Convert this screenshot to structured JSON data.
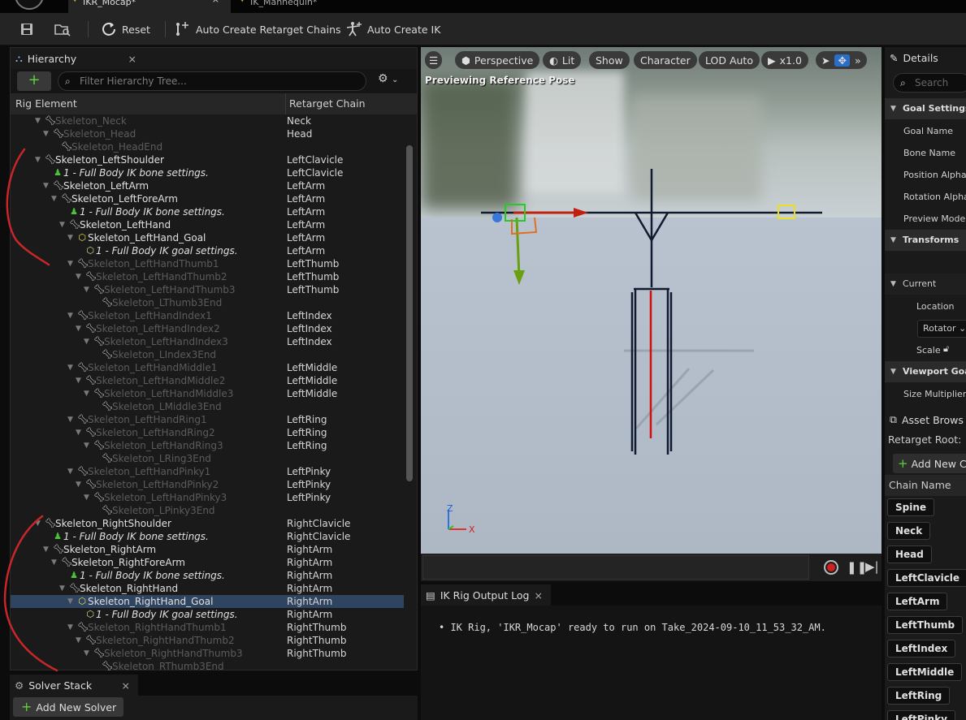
{
  "tabs": [
    {
      "label": "IKR_Mocap*"
    },
    {
      "label": "IK_Mannequin*"
    }
  ],
  "toolbar": {
    "reset_label": "Reset",
    "auto_chains_label": "Auto Create Retarget Chains",
    "auto_ik_label": "Auto Create IK"
  },
  "hierarchy": {
    "tab_label": "Hierarchy",
    "search_placeholder": "Filter Hierarchy Tree...",
    "col_element": "Rig Element",
    "col_chain": "Retarget Chain",
    "rows": [
      {
        "name": "Skeleton_Neck",
        "chain": "Neck",
        "indent": 0,
        "type": "bone",
        "style": "dim",
        "tri": "▼",
        "sel": false
      },
      {
        "name": "Skeleton_Head",
        "chain": "Head",
        "indent": 1,
        "type": "bone",
        "style": "dim",
        "tri": "▼",
        "sel": false
      },
      {
        "name": "Skeleton_HeadEnd",
        "chain": "",
        "indent": 2,
        "type": "bone",
        "style": "dim",
        "tri": "",
        "sel": false
      },
      {
        "name": "Skeleton_LeftShoulder",
        "chain": "LeftClavicle",
        "indent": 0,
        "type": "bone",
        "style": "lv",
        "tri": "▼",
        "sel": false
      },
      {
        "name": "1 - Full Body IK bone settings.",
        "chain": "LeftClavicle",
        "indent": 1,
        "type": "boneset",
        "style": "lv it",
        "tri": "",
        "sel": false
      },
      {
        "name": "Skeleton_LeftArm",
        "chain": "LeftArm",
        "indent": 1,
        "type": "bone",
        "style": "lv",
        "tri": "▼",
        "sel": false
      },
      {
        "name": "Skeleton_LeftForeArm",
        "chain": "LeftArm",
        "indent": 2,
        "type": "bone",
        "style": "lv",
        "tri": "▼",
        "sel": false
      },
      {
        "name": "1 - Full Body IK bone settings.",
        "chain": "LeftArm",
        "indent": 3,
        "type": "boneset",
        "style": "lv it",
        "tri": "",
        "sel": false
      },
      {
        "name": "Skeleton_LeftHand",
        "chain": "LeftArm",
        "indent": 3,
        "type": "bone",
        "style": "lv",
        "tri": "▼",
        "sel": false
      },
      {
        "name": "Skeleton_LeftHand_Goal",
        "chain": "LeftArm",
        "indent": 4,
        "type": "goal",
        "style": "lv",
        "tri": "▼",
        "sel": false
      },
      {
        "name": "1 - Full Body IK goal settings.",
        "chain": "LeftArm",
        "indent": 5,
        "type": "goalset",
        "style": "lv it",
        "tri": "",
        "sel": false
      },
      {
        "name": "Skeleton_LeftHandThumb1",
        "chain": "LeftThumb",
        "indent": 4,
        "type": "bone",
        "style": "dim",
        "tri": "▼",
        "sel": false
      },
      {
        "name": "Skeleton_LeftHandThumb2",
        "chain": "LeftThumb",
        "indent": 5,
        "type": "bone",
        "style": "dim",
        "tri": "▼",
        "sel": false
      },
      {
        "name": "Skeleton_LeftHandThumb3",
        "chain": "LeftThumb",
        "indent": 6,
        "type": "bone",
        "style": "dim",
        "tri": "▼",
        "sel": false
      },
      {
        "name": "Skeleton_LThumb3End",
        "chain": "",
        "indent": 7,
        "type": "bone",
        "style": "dim",
        "tri": "",
        "sel": false
      },
      {
        "name": "Skeleton_LeftHandIndex1",
        "chain": "LeftIndex",
        "indent": 4,
        "type": "bone",
        "style": "dim",
        "tri": "▼",
        "sel": false
      },
      {
        "name": "Skeleton_LeftHandIndex2",
        "chain": "LeftIndex",
        "indent": 5,
        "type": "bone",
        "style": "dim",
        "tri": "▼",
        "sel": false
      },
      {
        "name": "Skeleton_LeftHandIndex3",
        "chain": "LeftIndex",
        "indent": 6,
        "type": "bone",
        "style": "dim",
        "tri": "▼",
        "sel": false
      },
      {
        "name": "Skeleton_LIndex3End",
        "chain": "",
        "indent": 7,
        "type": "bone",
        "style": "dim",
        "tri": "",
        "sel": false
      },
      {
        "name": "Skeleton_LeftHandMiddle1",
        "chain": "LeftMiddle",
        "indent": 4,
        "type": "bone",
        "style": "dim",
        "tri": "▼",
        "sel": false
      },
      {
        "name": "Skeleton_LeftHandMiddle2",
        "chain": "LeftMiddle",
        "indent": 5,
        "type": "bone",
        "style": "dim",
        "tri": "▼",
        "sel": false
      },
      {
        "name": "Skeleton_LeftHandMiddle3",
        "chain": "LeftMiddle",
        "indent": 6,
        "type": "bone",
        "style": "dim",
        "tri": "▼",
        "sel": false
      },
      {
        "name": "Skeleton_LMiddle3End",
        "chain": "",
        "indent": 7,
        "type": "bone",
        "style": "dim",
        "tri": "",
        "sel": false
      },
      {
        "name": "Skeleton_LeftHandRing1",
        "chain": "LeftRing",
        "indent": 4,
        "type": "bone",
        "style": "dim",
        "tri": "▼",
        "sel": false
      },
      {
        "name": "Skeleton_LeftHandRing2",
        "chain": "LeftRing",
        "indent": 5,
        "type": "bone",
        "style": "dim",
        "tri": "▼",
        "sel": false
      },
      {
        "name": "Skeleton_LeftHandRing3",
        "chain": "LeftRing",
        "indent": 6,
        "type": "bone",
        "style": "dim",
        "tri": "▼",
        "sel": false
      },
      {
        "name": "Skeleton_LRing3End",
        "chain": "",
        "indent": 7,
        "type": "bone",
        "style": "dim",
        "tri": "",
        "sel": false
      },
      {
        "name": "Skeleton_LeftHandPinky1",
        "chain": "LeftPinky",
        "indent": 4,
        "type": "bone",
        "style": "dim",
        "tri": "▼",
        "sel": false
      },
      {
        "name": "Skeleton_LeftHandPinky2",
        "chain": "LeftPinky",
        "indent": 5,
        "type": "bone",
        "style": "dim",
        "tri": "▼",
        "sel": false
      },
      {
        "name": "Skeleton_LeftHandPinky3",
        "chain": "LeftPinky",
        "indent": 6,
        "type": "bone",
        "style": "dim",
        "tri": "▼",
        "sel": false
      },
      {
        "name": "Skeleton_LPinky3End",
        "chain": "",
        "indent": 7,
        "type": "bone",
        "style": "dim",
        "tri": "",
        "sel": false
      },
      {
        "name": "Skeleton_RightShoulder",
        "chain": "RightClavicle",
        "indent": 0,
        "type": "bone",
        "style": "lv",
        "tri": "▼",
        "sel": false
      },
      {
        "name": "1 - Full Body IK bone settings.",
        "chain": "RightClavicle",
        "indent": 1,
        "type": "boneset",
        "style": "lv it",
        "tri": "",
        "sel": false
      },
      {
        "name": "Skeleton_RightArm",
        "chain": "RightArm",
        "indent": 1,
        "type": "bone",
        "style": "lv",
        "tri": "▼",
        "sel": false
      },
      {
        "name": "Skeleton_RightForeArm",
        "chain": "RightArm",
        "indent": 2,
        "type": "bone",
        "style": "lv",
        "tri": "▼",
        "sel": false
      },
      {
        "name": "1 - Full Body IK bone settings.",
        "chain": "RightArm",
        "indent": 3,
        "type": "boneset",
        "style": "lv it",
        "tri": "",
        "sel": false
      },
      {
        "name": "Skeleton_RightHand",
        "chain": "RightArm",
        "indent": 3,
        "type": "bone",
        "style": "lv",
        "tri": "▼",
        "sel": false
      },
      {
        "name": "Skeleton_RightHand_Goal",
        "chain": "RightArm",
        "indent": 4,
        "type": "goal",
        "style": "lv",
        "tri": "▼",
        "sel": true
      },
      {
        "name": "1 - Full Body IK goal settings.",
        "chain": "RightArm",
        "indent": 5,
        "type": "goalset",
        "style": "lv it",
        "tri": "",
        "sel": false
      },
      {
        "name": "Skeleton_RightHandThumb1",
        "chain": "RightThumb",
        "indent": 4,
        "type": "bone",
        "style": "dim",
        "tri": "▼",
        "sel": false
      },
      {
        "name": "Skeleton_RightHandThumb2",
        "chain": "RightThumb",
        "indent": 5,
        "type": "bone",
        "style": "dim",
        "tri": "▼",
        "sel": false
      },
      {
        "name": "Skeleton_RightHandThumb3",
        "chain": "RightThumb",
        "indent": 6,
        "type": "bone",
        "style": "dim",
        "tri": "▼",
        "sel": false
      },
      {
        "name": "Skeleton_RThumb3End",
        "chain": "",
        "indent": 7,
        "type": "bone",
        "style": "dim",
        "tri": "",
        "sel": false
      }
    ]
  },
  "solver": {
    "tab_label": "Solver Stack",
    "add_label": "Add New Solver"
  },
  "viewport": {
    "perspective": "Perspective",
    "lit": "Lit",
    "show": "Show",
    "character": "Character",
    "lod": "LOD Auto",
    "speed": "x1.0",
    "preview_text": "Previewing Reference Pose",
    "axis_z": "Z",
    "axis_x": "X"
  },
  "log": {
    "tab_label": "IK Rig Output Log",
    "message": "IK Rig, 'IKR_Mocap' ready to run on Take_2024-09-10_11_53_32_AM."
  },
  "details": {
    "tab_label": "Details",
    "search_placeholder": "Search",
    "goal_settings": "Goal Settings",
    "goal_name": "Goal Name",
    "bone_name": "Bone Name",
    "position_alpha": "Position Alpha",
    "rotation_alpha": "Rotation Alpha",
    "preview_mode": "Preview Mode",
    "transforms": "Transforms",
    "current": "Current",
    "location": "Location",
    "rotator": "Rotator",
    "scale": "Scale",
    "viewport_goal": "Viewport Goal S",
    "size_multiplier": "Size Multiplier"
  },
  "asset": {
    "tab_label": "Asset Brows",
    "retarget_root": "Retarget Root:",
    "add_chain": "Add New C",
    "chain_header": "Chain Name",
    "chains": [
      "Spine",
      "Neck",
      "Head",
      "LeftClavicle",
      "LeftArm",
      "LeftThumb",
      "LeftIndex",
      "LeftMiddle",
      "LeftRing",
      "LeftPinky"
    ]
  },
  "colors": {
    "selection": "#2f4460",
    "accent_green": "#5fcf3a",
    "annotation_red": "#c8262a"
  }
}
